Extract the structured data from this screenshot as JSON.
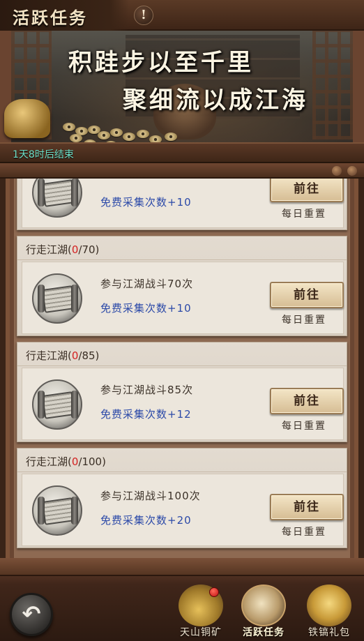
{
  "header": {
    "title": "活跃任务",
    "alert_glyph": "!"
  },
  "banner": {
    "slogan_line1": "积跬步以至千里",
    "slogan_line2": "聚细流以成江海",
    "timer": "1天8时后结束"
  },
  "tasks": [
    {
      "header_prefix": "",
      "progress_current": "",
      "progress_total": "",
      "description": "",
      "reward": "免费采集次数+10",
      "button_label": "前往",
      "reset_label": "每日重置"
    },
    {
      "header_prefix": "行走江湖(",
      "progress_current": "0",
      "progress_total": "/70)",
      "description": "参与江湖战斗70次",
      "reward": "免费采集次数+10",
      "button_label": "前往",
      "reset_label": "每日重置"
    },
    {
      "header_prefix": "行走江湖(",
      "progress_current": "0",
      "progress_total": "/85)",
      "description": "参与江湖战斗85次",
      "reward": "免费采集次数+12",
      "button_label": "前往",
      "reset_label": "每日重置"
    },
    {
      "header_prefix": "行走江湖(",
      "progress_current": "0",
      "progress_total": "/100)",
      "description": "参与江湖战斗100次",
      "reward": "免费采集次数+20",
      "button_label": "前往",
      "reset_label": "每日重置"
    }
  ],
  "bottom_nav": {
    "back_glyph": "↶",
    "items": [
      {
        "label": "天山铜矿",
        "icon": "pickaxe-icon",
        "has_badge": true
      },
      {
        "label": "活跃任务",
        "icon": "scroll-brush-icon",
        "active": true
      },
      {
        "label": "铁镐礼包",
        "icon": "gold-ingot-icon"
      }
    ]
  },
  "colors": {
    "progress_red": "#d42020",
    "reward_blue": "#2b49a8",
    "timer_teal": "#6fe0c8"
  }
}
